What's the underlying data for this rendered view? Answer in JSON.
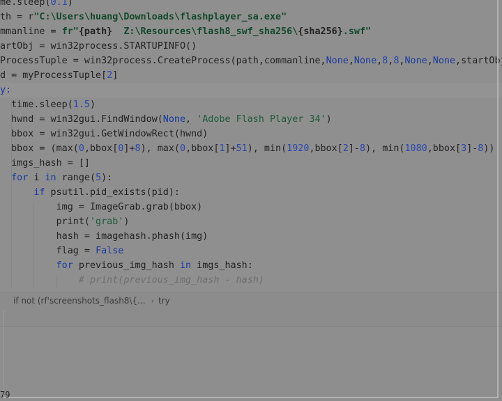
{
  "editor": {
    "lines": [
      [
        {
          "t": "me.sleep(",
          "c": "fn"
        },
        {
          "t": "0.1",
          "c": "num"
        },
        {
          "t": ")",
          "c": "fn"
        }
      ],
      [
        {
          "t": "th = r",
          "c": "fn"
        },
        {
          "t": "\"C:\\Users\\huang\\Downloads\\flashplayer_sa.exe\"",
          "c": "bstr"
        }
      ],
      [
        {
          "t": "mmanline = ",
          "c": "fn"
        },
        {
          "t": "fr\"",
          "c": "bstr"
        },
        {
          "t": "{path}",
          "c": "bold"
        },
        {
          "t": "  Z:\\Resources\\flash8_swf_sha256\\",
          "c": "bstr"
        },
        {
          "t": "{sha256}",
          "c": "bold"
        },
        {
          "t": ".swf\"",
          "c": "bstr"
        }
      ],
      [
        {
          "t": "artObj = win32process.STARTUPINFO()",
          "c": "fn"
        }
      ],
      [
        {
          "t": "ProcessTuple = win32process.CreateProcess(path,commanline,",
          "c": "fn"
        },
        {
          "t": "None",
          "c": "kw"
        },
        {
          "t": ",",
          "c": "fn"
        },
        {
          "t": "None",
          "c": "kw"
        },
        {
          "t": ",",
          "c": "fn"
        },
        {
          "t": "8",
          "c": "num"
        },
        {
          "t": ",",
          "c": "fn"
        },
        {
          "t": "8",
          "c": "num"
        },
        {
          "t": ",",
          "c": "fn"
        },
        {
          "t": "None",
          "c": "kw"
        },
        {
          "t": ",",
          "c": "fn"
        },
        {
          "t": "None",
          "c": "kw"
        },
        {
          "t": ",startObj",
          "c": "fn"
        }
      ],
      [
        {
          "t": "d = myProcessTuple[",
          "c": "fn"
        },
        {
          "t": "2",
          "c": "num"
        },
        {
          "t": "]",
          "c": "fn"
        }
      ],
      [
        {
          "t": "y:",
          "c": "kw"
        }
      ],
      [
        {
          "t": "  time.sleep(",
          "c": "fn"
        },
        {
          "t": "1.5",
          "c": "num"
        },
        {
          "t": ")",
          "c": "fn"
        }
      ],
      [
        {
          "t": "  hwnd = win32gui.FindWindow(",
          "c": "fn"
        },
        {
          "t": "None",
          "c": "kw"
        },
        {
          "t": ", ",
          "c": "fn"
        },
        {
          "t": "'Adobe Flash Player 34'",
          "c": "str"
        },
        {
          "t": ")",
          "c": "fn"
        }
      ],
      [
        {
          "t": "  bbox = win32gui.GetWindowRect(hwnd)",
          "c": "fn"
        }
      ],
      [
        {
          "t": "  bbox = (max(",
          "c": "fn"
        },
        {
          "t": "0",
          "c": "num"
        },
        {
          "t": ",bbox[",
          "c": "fn"
        },
        {
          "t": "0",
          "c": "num"
        },
        {
          "t": "]+",
          "c": "fn"
        },
        {
          "t": "8",
          "c": "num"
        },
        {
          "t": "), max(",
          "c": "fn"
        },
        {
          "t": "0",
          "c": "num"
        },
        {
          "t": ",bbox[",
          "c": "fn"
        },
        {
          "t": "1",
          "c": "num"
        },
        {
          "t": "]+",
          "c": "fn"
        },
        {
          "t": "51",
          "c": "num"
        },
        {
          "t": "), min(",
          "c": "fn"
        },
        {
          "t": "1920",
          "c": "num"
        },
        {
          "t": ",bbox[",
          "c": "fn"
        },
        {
          "t": "2",
          "c": "num"
        },
        {
          "t": "]-",
          "c": "fn"
        },
        {
          "t": "8",
          "c": "num"
        },
        {
          "t": "), min(",
          "c": "fn"
        },
        {
          "t": "1080",
          "c": "num"
        },
        {
          "t": ",bbox[",
          "c": "fn"
        },
        {
          "t": "3",
          "c": "num"
        },
        {
          "t": "]-",
          "c": "fn"
        },
        {
          "t": "8",
          "c": "num"
        },
        {
          "t": "))",
          "c": "fn"
        }
      ],
      [
        {
          "t": "  imgs_hash = []",
          "c": "fn"
        }
      ],
      [
        {
          "t": "  ",
          "c": "fn"
        },
        {
          "t": "for",
          "c": "kw"
        },
        {
          "t": " i ",
          "c": "fn"
        },
        {
          "t": "in",
          "c": "kw"
        },
        {
          "t": " range(",
          "c": "fn"
        },
        {
          "t": "5",
          "c": "num"
        },
        {
          "t": "):",
          "c": "fn"
        }
      ],
      [
        {
          "t": "      ",
          "c": "fn"
        },
        {
          "t": "if",
          "c": "kw"
        },
        {
          "t": " psutil.pid_exists(pid):",
          "c": "fn"
        }
      ],
      [
        {
          "t": "          img = ImageGrab.grab(bbox)",
          "c": "fn"
        }
      ],
      [
        {
          "t": "          print(",
          "c": "fn"
        },
        {
          "t": "'grab'",
          "c": "str"
        },
        {
          "t": ")",
          "c": "fn"
        }
      ],
      [
        {
          "t": "          hash = imagehash.phash(img)",
          "c": "fn"
        }
      ],
      [
        {
          "t": "          flag = ",
          "c": "fn"
        },
        {
          "t": "False",
          "c": "kw"
        }
      ],
      [
        {
          "t": "          ",
          "c": "fn"
        },
        {
          "t": "for",
          "c": "kw"
        },
        {
          "t": " previous_img_hash ",
          "c": "fn"
        },
        {
          "t": "in",
          "c": "kw"
        },
        {
          "t": " imgs_hash:",
          "c": "fn"
        }
      ],
      [
        {
          "t": "              ",
          "c": "fn"
        },
        {
          "t": "# print(previous_img_hash - hash)",
          "c": "cm"
        }
      ]
    ]
  },
  "breadcrumb": {
    "items": [
      {
        "label": "if not (rf'screenshots_flash8\\{..."
      },
      {
        "label": "try"
      }
    ],
    "separator": "›"
  },
  "console": {
    "partial_text": "79"
  }
}
